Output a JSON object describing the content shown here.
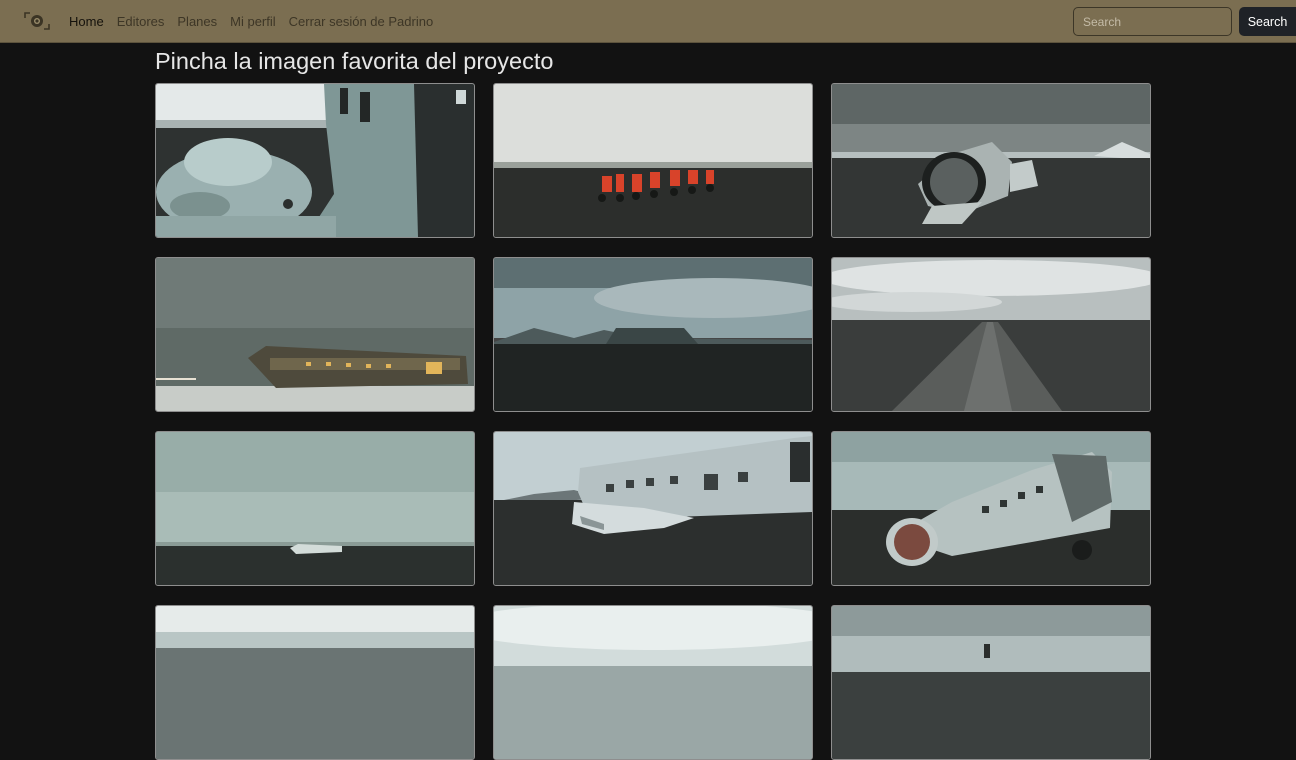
{
  "navbar": {
    "brand_icon": "camera-logo-icon",
    "links": [
      {
        "label": "Home",
        "active": true
      },
      {
        "label": "Editores"
      },
      {
        "label": "Planes"
      },
      {
        "label": "Mi perfil"
      },
      {
        "label": "Cerrar sesión de Padrino"
      }
    ],
    "search": {
      "placeholder": "Search",
      "value": "",
      "button_label": "Search"
    }
  },
  "main": {
    "title": "Pincha la imagen favorita del proyecto"
  },
  "colors": {
    "navbar_bg": "#7b6e51",
    "page_bg": "#121212",
    "search_button_bg": "#1f2227"
  }
}
